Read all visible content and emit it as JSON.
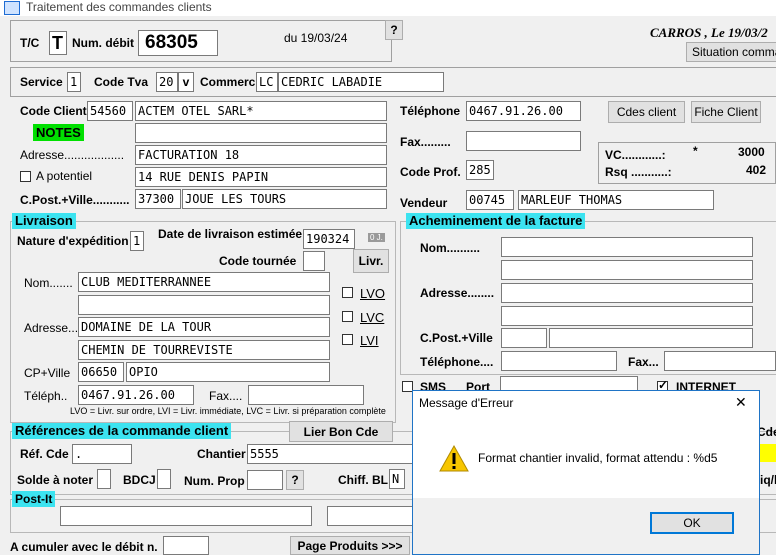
{
  "window": {
    "title": "Traitement des commandes clients"
  },
  "header": {
    "tc_label": "T/C",
    "tc_value": "T",
    "num_debit_label": "Num. débit",
    "num_debit_value": "68305",
    "date_text": "du 19/03/24",
    "help_label": "?",
    "location_text": "CARROS , Le 19/03/2",
    "situation_label": "Situation comman"
  },
  "service_row": {
    "service_label": "Service",
    "service_value": "1",
    "code_tva_label": "Code Tva",
    "code_tva_value": "20",
    "code_tva_arrow": "v",
    "commerc_label": "Commerc.",
    "commerc_code": "LC",
    "commerc_name": "CEDRIC LABADIE"
  },
  "client": {
    "code_client_label": "Code Client",
    "code_client_value": "54560",
    "client_name": "ACTEM OTEL SARL*",
    "notes_label": "NOTES",
    "adresse_label": "Adresse..................",
    "adresse1": "FACTURATION 18",
    "potentiel_label": "A potentiel",
    "adresse2": "14 RUE DENIS PAPIN",
    "cpville_label": "C.Post.+Ville...........",
    "cp_value": "37300",
    "ville_value": "JOUE LES TOURS",
    "telephone_label": "Téléphone",
    "telephone_value": "0467.91.26.00",
    "cdes_client_label": "Cdes client",
    "fiche_client_label": "Fiche Client",
    "fax_label": "Fax.........",
    "code_prof_label": "Code Prof.",
    "code_prof_value": "285",
    "vc_label": "VC............:",
    "vc_star": "*",
    "vc_value": "3000",
    "rsq_label": "Rsq ...........:",
    "rsq_value": "402",
    "vendeur_label": "Vendeur",
    "vendeur_code": "00745",
    "vendeur_name": "MARLEUF THOMAS"
  },
  "livraison": {
    "header": "Livraison",
    "nature_label": "Nature d'expédition",
    "nature_value": "1",
    "date_label": "Date de livraison estimée",
    "date_value": "190324",
    "zero_j": "0 J.",
    "code_tournee_label": "Code tournée",
    "livr_label": "Livr.",
    "nom_label": "Nom.......",
    "nom_value": "CLUB MEDITERRANNEE",
    "adresse_label": "Adresse...",
    "adresse1": "DOMAINE DE LA TOUR",
    "adresse2": "CHEMIN DE TOURREVISTE",
    "cpville_label": "CP+Ville",
    "cp_value": "06650",
    "ville_value": "OPIO",
    "teleph_label": "Téléph..",
    "teleph_value": "0467.91.26.00",
    "fax_label": "Fax....",
    "lvo_label": "LVO",
    "lvc_label": "LVC",
    "lvi_label": "LVI",
    "legend": "LVO = Livr. sur ordre, LVI = Livr. immédiate, LVC = Livr. si préparation complète"
  },
  "acheminement": {
    "header": "Acheminement de la facture",
    "nom_label": "Nom..........",
    "adresse_label": "Adresse........",
    "cpville_label": "C.Post.+Ville",
    "telephone_label": "Téléphone....",
    "fax_label": "Fax...",
    "sms_label": "SMS",
    "port_label": "Port",
    "internet_label": "INTERNET"
  },
  "references": {
    "header": "Références de la commande client",
    "lier_label": "Lier Bon Cde",
    "cde_clipped": "Cde",
    "ref_cde_label": "Réf. Cde",
    "ref_cde_value": ".",
    "chantier_label": "Chantier",
    "chantier_value": "5555",
    "solde_label": "Solde à noter",
    "bdcj_label": "BDCJ",
    "num_prop_label": "Num. Prop",
    "help_label": "?",
    "chiff_bl_label": "Chiff. BL",
    "chiff_bl_value": "N",
    "right_clipped": "iq/l"
  },
  "postit": {
    "header": "Post-It"
  },
  "footer": {
    "cumuler_label": "A cumuler avec le débit n.",
    "page_produits_label": "Page Produits >>>",
    "btn_partial_1": "...",
    "btn_partial_2": "..."
  },
  "dialog": {
    "title": "Message d'Erreur",
    "close_label": "✕",
    "message": "Format chantier invalid, format attendu : %d5",
    "ok_label": "OK"
  }
}
